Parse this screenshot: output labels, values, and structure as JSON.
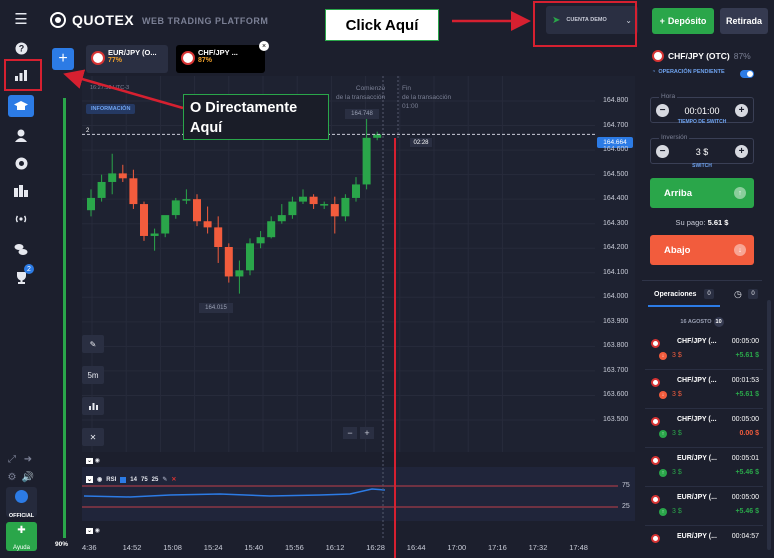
{
  "brand": {
    "name": "QUOTEX",
    "subtitle": "WEB TRADING PLATFORM"
  },
  "account": {
    "label": "CUENTA DEMO"
  },
  "buttons": {
    "deposit": "Depósito",
    "withdraw": "Retirada"
  },
  "assets": [
    {
      "name": "EUR/JPY (O...",
      "payout": "77%"
    },
    {
      "name": "CHF/JPY ...",
      "payout": "87%"
    }
  ],
  "chart": {
    "time": "16:27:33 UTC-3",
    "info_badge": "INFORMACIÓN",
    "level_two": "2",
    "start_label": [
      "Comienzo",
      "de la transacción"
    ],
    "end_label": [
      "Fin",
      "de la transacción",
      "01:00"
    ],
    "high_price": "164.748",
    "low_price": "164.015",
    "current_price": "164.664",
    "countdown": "02:28",
    "price_ticks": [
      "164.800",
      "164.700",
      "164.600",
      "164.500",
      "164.400",
      "164.300",
      "164.200",
      "164.100",
      "164.000",
      "163.900",
      "163.800",
      "163.700",
      "163.600",
      "163.500"
    ],
    "time_ticks": [
      "4:36",
      "14:52",
      "15:08",
      "15:24",
      "15:40",
      "15:56",
      "16:12",
      "16:28",
      "16:44",
      "17:00",
      "17:16",
      "17:32",
      "17:48"
    ],
    "timeframe": "5m",
    "zoom_minus": "−",
    "zoom_plus": "+"
  },
  "chart_data": {
    "type": "candlestick",
    "x": [
      "14:36",
      "14:40",
      "14:44",
      "14:48",
      "14:52",
      "14:56",
      "15:00",
      "15:04",
      "15:08",
      "15:12",
      "15:16",
      "15:20",
      "15:24",
      "15:28",
      "15:32",
      "15:36",
      "15:40",
      "15:44",
      "15:48",
      "15:52",
      "15:56",
      "16:00",
      "16:04",
      "16:08",
      "16:12",
      "16:16",
      "16:20",
      "16:24"
    ],
    "series": [
      {
        "open": [
          164.355,
          164.405,
          164.47,
          164.505,
          164.485,
          164.38,
          164.25,
          164.26,
          164.335,
          164.395,
          164.4,
          164.31,
          164.285,
          164.205,
          164.085,
          164.11,
          164.22,
          164.245,
          164.31,
          164.335,
          164.39,
          164.41,
          164.38,
          164.38,
          164.33,
          164.405,
          164.46,
          164.65
        ],
        "close": [
          164.405,
          164.47,
          164.505,
          164.485,
          164.38,
          164.25,
          164.26,
          164.335,
          164.395,
          164.4,
          164.31,
          164.285,
          164.205,
          164.085,
          164.11,
          164.22,
          164.245,
          164.31,
          164.335,
          164.39,
          164.41,
          164.38,
          164.38,
          164.33,
          164.405,
          164.46,
          164.65,
          164.664
        ],
        "high": [
          164.44,
          164.5,
          164.585,
          164.54,
          164.52,
          164.39,
          164.28,
          164.32,
          164.405,
          164.44,
          164.42,
          164.37,
          164.33,
          164.22,
          164.15,
          164.24,
          164.27,
          164.33,
          164.38,
          164.41,
          164.44,
          164.42,
          164.39,
          164.41,
          164.42,
          164.49,
          164.748,
          164.675
        ],
        "low": [
          164.33,
          164.39,
          164.42,
          164.47,
          164.36,
          164.23,
          164.19,
          164.245,
          164.32,
          164.38,
          164.29,
          164.26,
          164.14,
          164.06,
          164.015,
          164.09,
          164.2,
          164.24,
          164.3,
          164.32,
          164.38,
          164.36,
          164.36,
          164.26,
          164.31,
          164.39,
          164.44,
          164.64
        ]
      }
    ],
    "ylim": [
      163.45,
      164.85
    ],
    "current_price": 164.664,
    "rsi": {
      "periods": [
        "14",
        "75",
        "25"
      ],
      "levels": [
        75,
        25
      ]
    }
  },
  "rsi": {
    "label": "RSI",
    "p1": "14",
    "p2": "75",
    "p3": "25",
    "lvl_high": "75",
    "lvl_low": "25"
  },
  "progress": {
    "label": "90%",
    "value": 90
  },
  "panel": {
    "asset": "CHF/JPY (OTC)",
    "payout": "87%",
    "pending": "OPERACIÓN PENDIENTE",
    "time_label": "Hora",
    "time_value": "00:01:00",
    "time_sub": "TIEMPO DE SWITCH",
    "investment_label": "Inversión",
    "investment_value": "3 $",
    "investment_sub": "SWITCH",
    "up": "Arriba",
    "payout_label": "Su pago:",
    "payout_value": "5.61 $",
    "down": "Abajo"
  },
  "operations": {
    "tab": "Operaciones",
    "count": "0",
    "count2": "0",
    "date": "16 AGOSTO",
    "date_count": "10",
    "items": [
      {
        "name": "CHF/JPY (...",
        "time": "00:05:00",
        "amount": "3 $",
        "result": "+5.61 $",
        "dir": "down"
      },
      {
        "name": "CHF/JPY (...",
        "time": "00:01:53",
        "amount": "3 $",
        "result": "+5.61 $",
        "dir": "down"
      },
      {
        "name": "CHF/JPY (...",
        "time": "00:05:00",
        "amount": "3 $",
        "result": "0.00 $",
        "dir": "up"
      },
      {
        "name": "EUR/JPY (...",
        "time": "00:05:01",
        "amount": "3 $",
        "result": "+5.46 $",
        "dir": "up"
      },
      {
        "name": "EUR/JPY (...",
        "time": "00:05:00",
        "amount": "3 $",
        "result": "+5.46 $",
        "dir": "up"
      },
      {
        "name": "EUR/JPY (...",
        "time": "00:04:57",
        "amount": "",
        "result": "",
        "dir": "up"
      }
    ]
  },
  "sidebar": {
    "official": "OFFICIAL",
    "help": "Ayuda",
    "notif": "2"
  },
  "annotations": {
    "top": "Click Aquí",
    "left_line1": "O Directamente",
    "left_line2": "Aquí"
  },
  "colors": {
    "up": "#2aa64a",
    "down": "#f25c3d",
    "accent": "#2c7be5",
    "annotation": "#d62030"
  }
}
